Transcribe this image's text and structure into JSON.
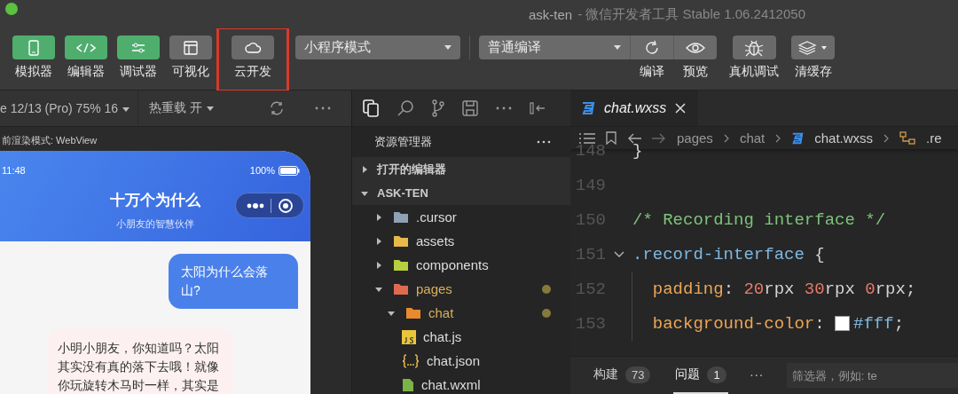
{
  "window": {
    "title": "ask-ten",
    "subtitle": "- 微信开发者工具 Stable 1.06.2412050"
  },
  "toolbar": {
    "toggles": [
      {
        "label": "模拟器",
        "on": true,
        "highlighted": false
      },
      {
        "label": "编辑器",
        "on": true,
        "highlighted": false
      },
      {
        "label": "调试器",
        "on": true,
        "highlighted": false
      },
      {
        "label": "可视化",
        "on": false,
        "highlighted": false
      },
      {
        "label": "云开发",
        "on": false,
        "highlighted": true
      }
    ],
    "mode_select": "小程序模式",
    "compile_select": "普通编译",
    "actions": [
      {
        "label": "编译"
      },
      {
        "label": "预览"
      },
      {
        "label": "真机调试"
      },
      {
        "label": "清缓存"
      }
    ]
  },
  "simulator": {
    "device": "e 12/13 (Pro) 75% 16",
    "hot_reload": "热重载 开",
    "render_mode": "前渲染模式: WebView",
    "phone": {
      "time": "11:48",
      "battery": "100%",
      "title": "十万个为什么",
      "subtitle": "小朋友的智慧伙伴",
      "messages": [
        {
          "kind": "user",
          "text": "太阳为什么会落山?"
        },
        {
          "kind": "bot",
          "text": "小明小朋友，你知道吗？太阳其实没有真的落下去哦！就像你玩旋转木马时一样，其实是"
        }
      ]
    }
  },
  "explorer": {
    "title": "资源管理器",
    "sections": [
      {
        "label": "打开的编辑器",
        "expanded": false
      },
      {
        "label": "ASK-TEN",
        "expanded": true
      }
    ],
    "tree": [
      {
        "name": ".cursor",
        "kind": "folder",
        "color": "#8fa1b3",
        "expanded": false,
        "modified": false
      },
      {
        "name": "assets",
        "kind": "folder",
        "color": "#e8b84a",
        "expanded": false,
        "modified": false
      },
      {
        "name": "components",
        "kind": "folder",
        "color": "#b6cf3f",
        "expanded": false,
        "modified": false
      },
      {
        "name": "pages",
        "kind": "folder",
        "color": "#e06a50",
        "expanded": true,
        "modified": true,
        "children": [
          {
            "name": "chat",
            "kind": "folder",
            "color": "#e98a2e",
            "expanded": true,
            "modified": true,
            "children": [
              {
                "name": "chat.js",
                "kind": "js",
                "modified": false
              },
              {
                "name": "chat.json",
                "kind": "json",
                "modified": false
              },
              {
                "name": "chat.wxml",
                "kind": "wxml",
                "modified": false
              }
            ]
          }
        ]
      }
    ]
  },
  "editor": {
    "tab": "chat.wxss",
    "breadcrumb": [
      "pages",
      "chat",
      "chat.wxss",
      ".re"
    ],
    "lines": [
      {
        "number": "148",
        "tokens": [
          {
            "kind": "punct",
            "text": "}"
          }
        ]
      },
      {
        "number": "149"
      },
      {
        "number": "150",
        "tokens": [
          {
            "kind": "comment",
            "text": "/* Recording interface */"
          }
        ]
      },
      {
        "number": "151",
        "fold": true,
        "tokens": [
          {
            "kind": "selector",
            "text": ".record-interface"
          },
          {
            "kind": "punct",
            "text": " {"
          }
        ]
      },
      {
        "number": "152",
        "tokens": [
          {
            "kind": "property",
            "text": "  padding"
          },
          {
            "kind": "punct",
            "text": ": "
          },
          {
            "kind": "number",
            "text": "20"
          },
          {
            "kind": "plain",
            "text": "rpx "
          },
          {
            "kind": "number",
            "text": "30"
          },
          {
            "kind": "plain",
            "text": "rpx "
          },
          {
            "kind": "number",
            "text": "0"
          },
          {
            "kind": "plain",
            "text": "rpx"
          },
          {
            "kind": "punct",
            "text": ";"
          }
        ]
      },
      {
        "number": "153",
        "tokens": [
          {
            "kind": "property",
            "text": "  background-color"
          },
          {
            "kind": "punct",
            "text": ": "
          },
          {
            "kind": "swatch",
            "color": "#ffffff"
          },
          {
            "kind": "value",
            "text": "#fff"
          },
          {
            "kind": "punct",
            "text": ";"
          }
        ]
      }
    ]
  },
  "panel": {
    "tabs": [
      {
        "label": "构建",
        "count": "73",
        "selected": false
      },
      {
        "label": "问题",
        "count": "1",
        "selected": true
      }
    ],
    "more": "···",
    "filter_placeholder": "筛选器，例如: te"
  }
}
